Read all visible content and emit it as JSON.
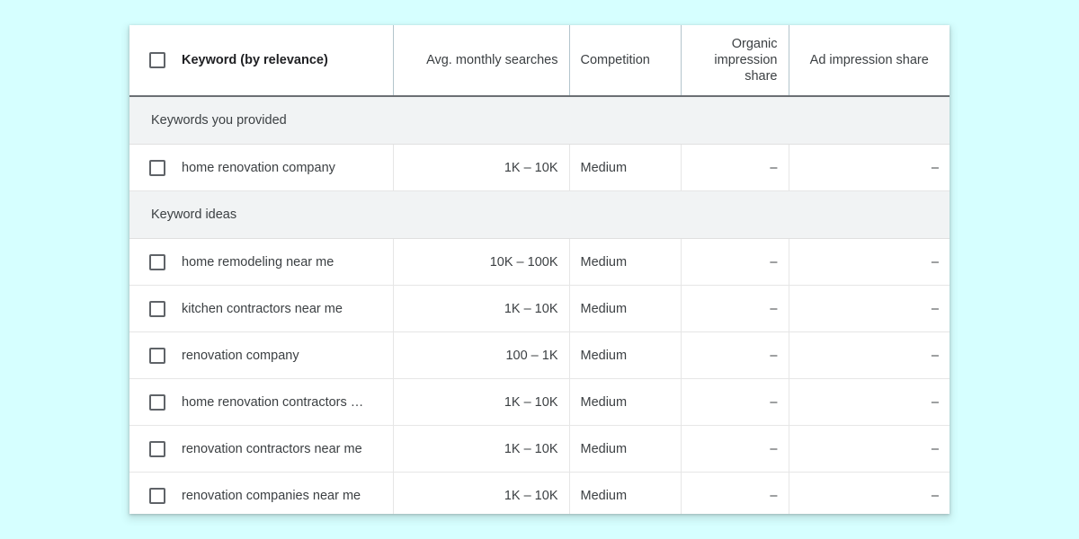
{
  "theme": {
    "page_background": "#d6ffff",
    "card_background": "#ffffff",
    "section_row_background": "#f1f3f4",
    "text_color": "#3c4043",
    "header_divider_color": "#b3c4cc",
    "row_divider_color": "#e6e6e6"
  },
  "table": {
    "columns": [
      {
        "key": "keyword",
        "label": "Keyword (by relevance)",
        "align": "left"
      },
      {
        "key": "searches",
        "label": "Avg. monthly searches",
        "align": "right"
      },
      {
        "key": "competition",
        "label": "Competition",
        "align": "left"
      },
      {
        "key": "organic",
        "label": "Organic impression share",
        "align": "right"
      },
      {
        "key": "adshare",
        "label": "Ad impression share",
        "align": "center"
      }
    ],
    "header": {
      "keyword": "Keyword (by relevance)",
      "searches": "Avg. monthly searches",
      "competition": "Competition",
      "organic_line1": "Organic",
      "organic_line2": "impression",
      "organic_line3": "share",
      "adshare": "Ad impression share",
      "select_all_checkbox": "unchecked"
    },
    "sections": [
      {
        "title": "Keywords you provided",
        "rows": [
          {
            "checkbox": "unchecked",
            "keyword": "home renovation company",
            "searches": "1K – 10K",
            "competition": "Medium",
            "organic": "–",
            "adshare": "–"
          }
        ]
      },
      {
        "title": "Keyword ideas",
        "rows": [
          {
            "checkbox": "unchecked",
            "keyword": "home remodeling near me",
            "searches": "10K – 100K",
            "competition": "Medium",
            "organic": "–",
            "adshare": "–"
          },
          {
            "checkbox": "unchecked",
            "keyword": "kitchen contractors near me",
            "searches": "1K – 10K",
            "competition": "Medium",
            "organic": "–",
            "adshare": "–"
          },
          {
            "checkbox": "unchecked",
            "keyword": "renovation company",
            "searches": "100 – 1K",
            "competition": "Medium",
            "organic": "–",
            "adshare": "–"
          },
          {
            "checkbox": "unchecked",
            "keyword": "home renovation contractors …",
            "searches": "1K – 10K",
            "competition": "Medium",
            "organic": "–",
            "adshare": "–"
          },
          {
            "checkbox": "unchecked",
            "keyword": "renovation contractors near me",
            "searches": "1K – 10K",
            "competition": "Medium",
            "organic": "–",
            "adshare": "–"
          },
          {
            "checkbox": "unchecked",
            "keyword": "renovation companies near me",
            "searches": "1K – 10K",
            "competition": "Medium",
            "organic": "–",
            "adshare": "–"
          }
        ]
      }
    ]
  }
}
